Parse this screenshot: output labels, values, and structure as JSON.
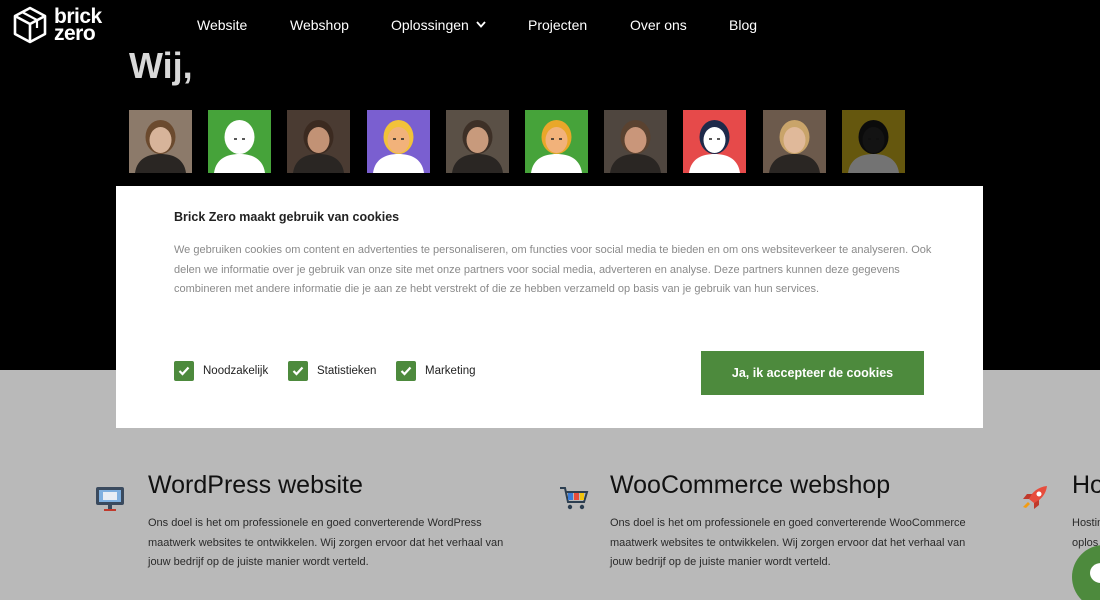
{
  "header": {
    "logo_line1": "brick",
    "logo_line2": "zero",
    "nav": [
      "Website",
      "Webshop",
      "Oplossingen",
      "Projecten",
      "Over ons",
      "Blog"
    ]
  },
  "hero": {
    "title": "Wij,"
  },
  "team": {
    "avatars": [
      {
        "style": "photo",
        "bg": "#8c7a6a",
        "face": "#d7b49a",
        "hair": "#6b4a2e"
      },
      {
        "style": "illustration",
        "bg": "#46a33a",
        "face": "#ffffff",
        "hair": "#ffffff"
      },
      {
        "style": "photo",
        "bg": "#4a3b32",
        "face": "#c29275",
        "hair": "#3b2a20"
      },
      {
        "style": "illustration",
        "bg": "#7a5fd0",
        "face": "#f2b27a",
        "hair": "#f2c23a"
      },
      {
        "style": "photo",
        "bg": "#5a5046",
        "face": "#c89a7c",
        "hair": "#3d3027"
      },
      {
        "style": "illustration",
        "bg": "#46a33a",
        "face": "#f2b27a",
        "hair": "#e9a72a"
      },
      {
        "style": "photo",
        "bg": "#4f463f",
        "face": "#c9967a",
        "hair": "#5a4230"
      },
      {
        "style": "illustration",
        "bg": "#e64a4a",
        "face": "#ffffff",
        "hair": "#1e2a4a"
      },
      {
        "style": "photo",
        "bg": "#6c5a4c",
        "face": "#e0b99a",
        "hair": "#c9a46a"
      },
      {
        "style": "illustration",
        "bg": "#e0c021",
        "face": "#2b2b2b",
        "hair": "#1a1a1a"
      }
    ]
  },
  "cookie_banner": {
    "title": "Brick Zero maakt gebruik van cookies",
    "body": "We gebruiken cookies om content en advertenties te personaliseren, om functies voor social media te bieden en om ons websiteverkeer te analyseren. Ook delen we informatie over je gebruik van onze site met onze partners voor social media, adverteren en analyse. Deze partners kunnen deze gegevens combineren met andere informatie die je aan ze hebt verstrekt of die ze hebben verzameld op basis van je gebruik van hun services.",
    "options": [
      {
        "label": "Noodzakelijk",
        "checked": true
      },
      {
        "label": "Statistieken",
        "checked": true
      },
      {
        "label": "Marketing",
        "checked": true
      }
    ],
    "accept_label": "Ja, ik accepteer de cookies"
  },
  "features": [
    {
      "icon": "monitor-icon",
      "title": "WordPress website",
      "text": "Ons doel is het om professionele en goed converterende WordPress maatwerk websites te ontwikkelen. Wij zorgen ervoor dat het verhaal van jouw bedrijf op de juiste manier wordt verteld."
    },
    {
      "icon": "shopping-cart-icon",
      "title": "WooCommerce webshop",
      "text": "Ons doel is het om professionele en goed converterende WooCommerce maatwerk websites te ontwikkelen. Wij zorgen ervoor dat het verhaal van jouw bedrijf op de juiste manier wordt verteld."
    },
    {
      "icon": "rocket-icon",
      "title": "Ho",
      "text": "Hostin oplos"
    }
  ],
  "colors": {
    "accent_green": "#4d8a3d",
    "hero_bg": "#000000",
    "section_bg": "#b9b9b9"
  }
}
